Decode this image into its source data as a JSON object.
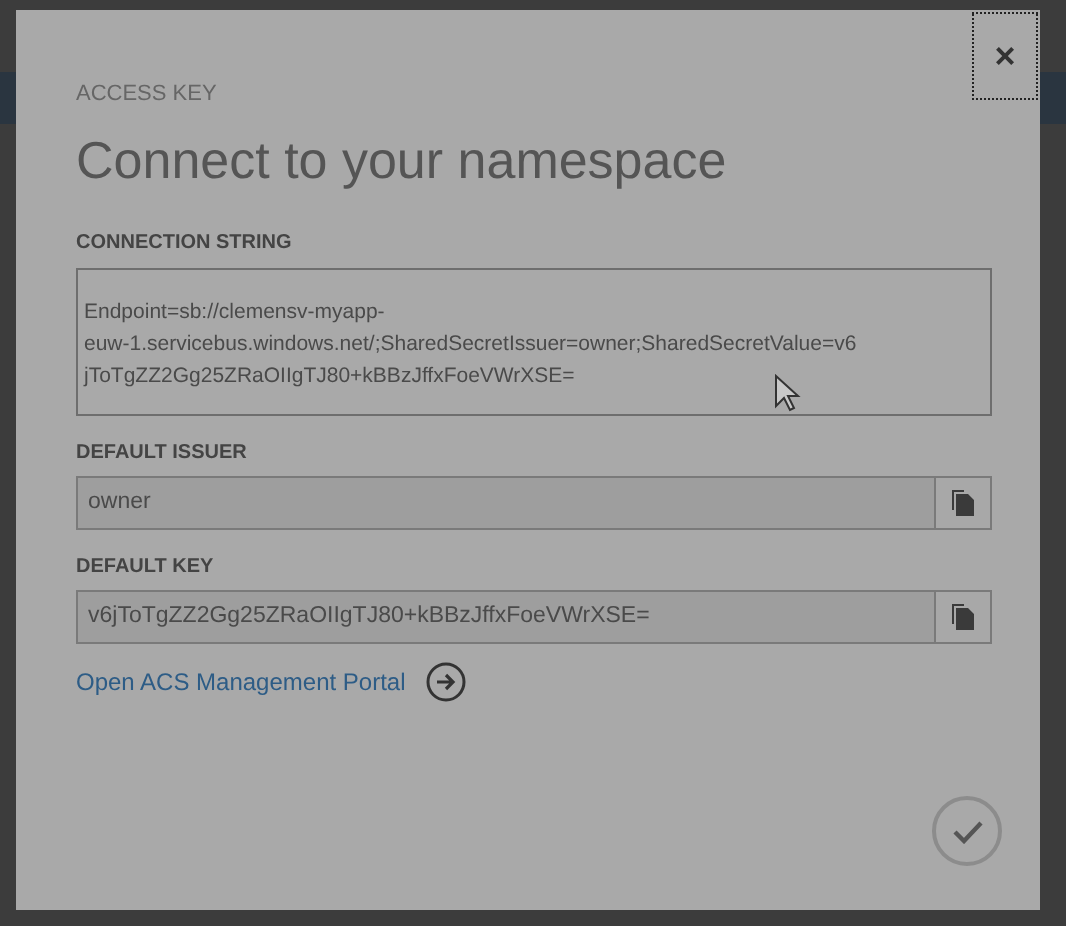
{
  "dialog": {
    "eyebrow": "ACCESS KEY",
    "title": "Connect to your namespace",
    "close_label": "×",
    "fields": [
      {
        "kind": "textarea",
        "label": "CONNECTION STRING",
        "value": "Endpoint=sb://clemensv-myapp-\neuw-1.servicebus.windows.net/;SharedSecretIssuer=owner;SharedSecretValue=v6\njToTgZZ2Gg25ZRaOIIgTJ80+kBBzJffxFoeVWrXSE="
      },
      {
        "kind": "copy",
        "label": "DEFAULT ISSUER",
        "value": "owner"
      },
      {
        "kind": "copy",
        "label": "DEFAULT KEY",
        "value": "v6jToTgZZ2Gg25ZRaOIIgTJ80+kBBzJffxFoeVWrXSE="
      }
    ],
    "link": "Open ACS Management Portal"
  }
}
